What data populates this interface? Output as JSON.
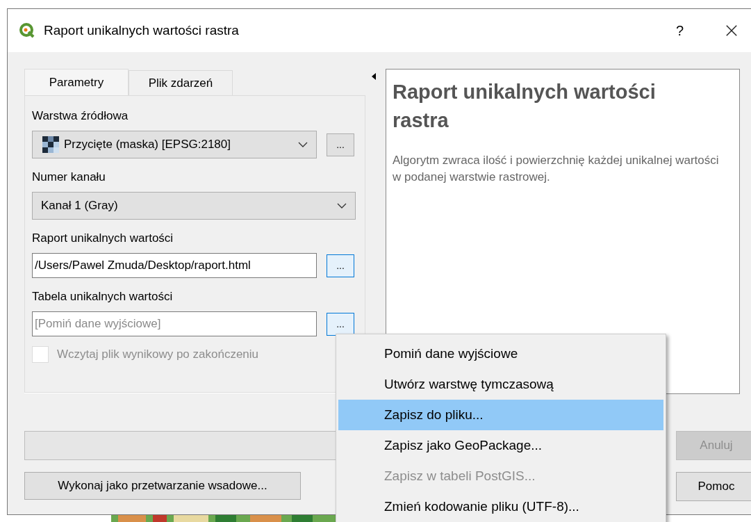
{
  "window": {
    "title": "Raport unikalnych wartości rastra",
    "help_button": "?"
  },
  "tabs": [
    {
      "label": "Parametry",
      "selected": true
    },
    {
      "label": "Plik zdarzeń",
      "selected": false
    }
  ],
  "fields": [
    {
      "kind": "layer_combo",
      "label": "Warstwa źródłowa",
      "value": "Przycięte (maska) [EPSG:2180]",
      "button": "...",
      "button_highlighted": false
    },
    {
      "kind": "combo",
      "label": "Numer kanału",
      "value": "Kanał 1 (Gray)"
    },
    {
      "kind": "file",
      "label": "Raport unikalnych wartości",
      "value": "/Users/Pawel Zmuda/Desktop/raport.html",
      "button": "...",
      "button_highlighted": true
    },
    {
      "kind": "file",
      "label": "Tabela unikalnych wartości",
      "placeholder": "[Pomiń dane wyjściowe]",
      "button": "...",
      "button_highlighted": true
    },
    {
      "kind": "checkbox",
      "label": "Wczytaj plik wynikowy po zakończeniu",
      "checked": false,
      "disabled": true
    }
  ],
  "help": {
    "title": "Raport unikalnych wartości rastra",
    "description": "Algorytm zwraca ilość i powierzchnię każdej unikalnej wartości w podanej warstwie rastrowej."
  },
  "progress": {
    "level": 0
  },
  "cancel_button": {
    "label": "Anuluj",
    "disabled": true
  },
  "batch_button": {
    "label": "Wykonaj jako przetwarzanie wsadowe..."
  },
  "help_button": {
    "label": "Pomoc"
  },
  "menu": [
    {
      "label": "Pomiń dane wyjściowe",
      "selected": false,
      "disabled": false
    },
    {
      "label": "Utwórz warstwę tymczasową",
      "selected": false,
      "disabled": false
    },
    {
      "label": "Zapisz do pliku...",
      "selected": true,
      "disabled": false
    },
    {
      "label": "Zapisz jako GeoPackage...",
      "selected": false,
      "disabled": false
    },
    {
      "label": "Zapisz w tabeli PostGIS...",
      "selected": false,
      "disabled": true
    },
    {
      "label": "Zmień kodowanie pliku (UTF-8)...",
      "selected": false,
      "disabled": false
    }
  ]
}
